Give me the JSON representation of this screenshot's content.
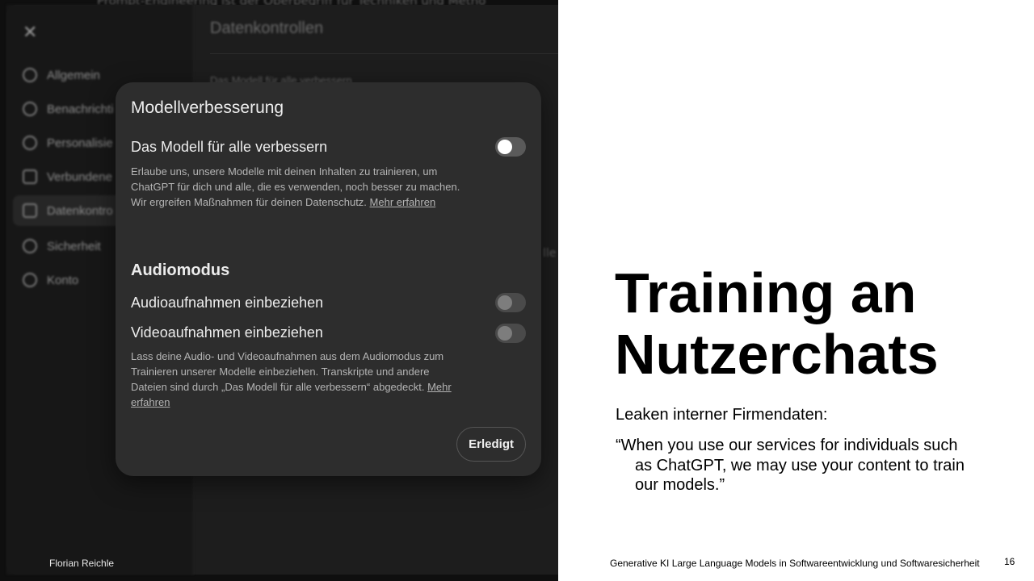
{
  "screenshot": {
    "background_heading": "Datenkontrollen",
    "background_subtext": "Das Modell für alle verbessern",
    "background_topline": "Prompt-Engineering ist der Oberbegriff für Techniken und Metho",
    "background_ghost": "lle",
    "close_icon": "close-icon",
    "sidebar": {
      "items": [
        {
          "label": "Allgemein",
          "icon": "gear-icon"
        },
        {
          "label": "Benachrichti",
          "icon": "bell-icon"
        },
        {
          "label": "Personalisie",
          "icon": "clock-icon"
        },
        {
          "label": "Verbundene",
          "icon": "apps-icon"
        },
        {
          "label": "Datenkontro",
          "icon": "database-icon"
        },
        {
          "label": "Sicherheit",
          "icon": "shield-icon"
        },
        {
          "label": "Konto",
          "icon": "user-icon"
        }
      ]
    },
    "modal": {
      "title": "Modellverbesserung",
      "improve_label": "Das Modell für alle verbessern",
      "improve_desc": "Erlaube uns, unsere Modelle mit deinen Inhalten zu trainieren, um ChatGPT für dich und alle, die es verwenden, noch besser zu machen. Wir ergreifen Maßnahmen für deinen Datenschutz.",
      "improve_link": "Mehr erfahren",
      "audio_section": "Audiomodus",
      "audio_label": "Audioaufnahmen einbeziehen",
      "video_label": "Videoaufnahmen einbeziehen",
      "audio_desc": "Lass deine Audio- und Videoaufnahmen aus dem Audiomodus zum Trainieren unserer Modelle einbeziehen. Transkripte und andere Dateien sind durch „Das Modell für alle verbessern“ abgedeckt.",
      "audio_link": "Mehr erfahren",
      "done_button": "Erledigt"
    }
  },
  "slide": {
    "title_line1": "Training an",
    "title_line2": "Nutzerchats",
    "subtitle": "Leaken interner Firmendaten:",
    "quote": "“When you use our services for individuals such as ChatGPT, we may use your content to train our models.”",
    "footer_left": "Florian Reichle",
    "footer_right": "Generative KI Large Language Models in Softwareentwicklung und Softwaresicherheit",
    "page_number": "16"
  }
}
